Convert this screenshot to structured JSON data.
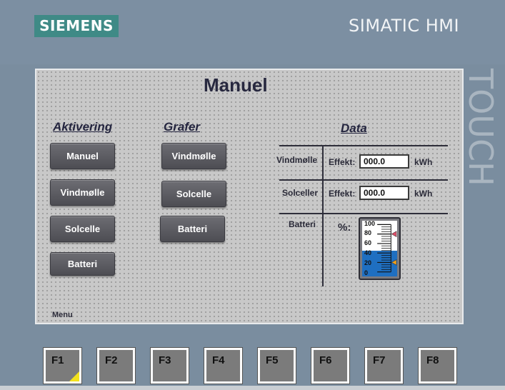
{
  "brand": {
    "logo": "SIEMENS",
    "product": "SIMATIC HMI",
    "side_label": "TOUCH"
  },
  "screen": {
    "title": "Manuel",
    "aktivering": {
      "heading": "Aktivering",
      "buttons": [
        "Manuel",
        "Vindmølle",
        "Solcelle",
        "Batteri"
      ]
    },
    "grafer": {
      "heading": "Grafer",
      "buttons": [
        "Vindmølle",
        "Solcelle",
        "Batteri"
      ]
    },
    "data": {
      "heading": "Data",
      "rows": [
        {
          "label": "Vindmølle",
          "field_label": "Effekt:",
          "value": "000.0",
          "unit": "kWh"
        },
        {
          "label": "Solceller",
          "field_label": "Effekt:",
          "value": "000.0",
          "unit": "kWh"
        }
      ],
      "battery": {
        "label": "Batteri",
        "percent_label": "%:",
        "scale": [
          "100",
          "80",
          "60",
          "40",
          "20",
          "0"
        ],
        "level_percent": 45,
        "upper_marker_percent": 80,
        "lower_marker_percent": 20,
        "colors": {
          "fill": "#1f6fc1",
          "upper_marker": "#e0506a",
          "lower_marker": "#f2a21c"
        }
      }
    },
    "menu_label": "Menu"
  },
  "function_keys": [
    "F1",
    "F2",
    "F3",
    "F4",
    "F5",
    "F6",
    "F7",
    "F8"
  ],
  "colors": {
    "bezel": "#7a8d9f",
    "logo_bg": "#3f8a86",
    "screen_bg": "#c8c8c8",
    "fkey_corner": "#f2e11c"
  }
}
